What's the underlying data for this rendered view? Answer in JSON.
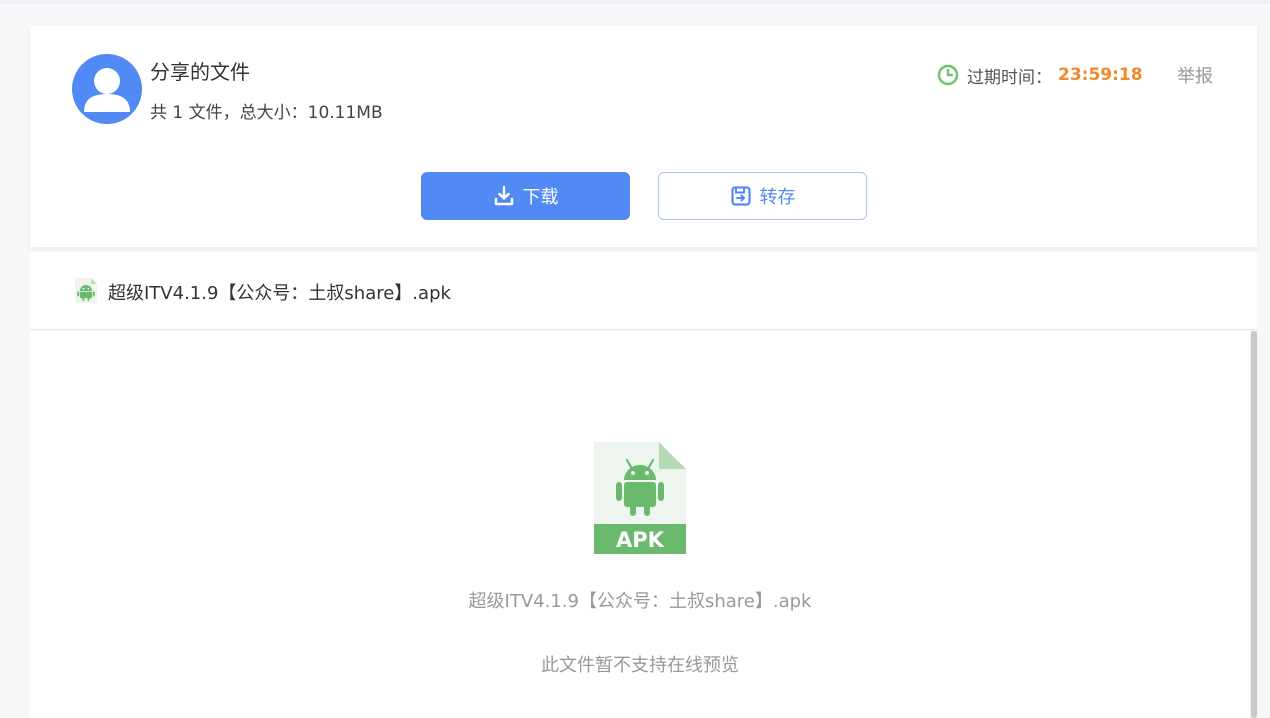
{
  "share": {
    "title": "分享的文件",
    "meta": "共 1 文件，总大小：10.11MB",
    "expire_label": "过期时间：",
    "expire_time": "23:59:18",
    "report_label": "举报"
  },
  "actions": {
    "download_label": "下载",
    "save_label": "转存"
  },
  "file": {
    "name": "超级ITV4.1.9【公众号：土叔share】.apk",
    "icon": "android-apk-file-icon"
  },
  "preview": {
    "badge": "APK",
    "name": "超级ITV4.1.9【公众号：土叔share】.apk",
    "note": "此文件暂不支持在线预览"
  },
  "colors": {
    "accent": "#5189f5",
    "expire": "#f08a2a",
    "clock": "#6cc36b",
    "apk_green": "#6ab96c"
  }
}
